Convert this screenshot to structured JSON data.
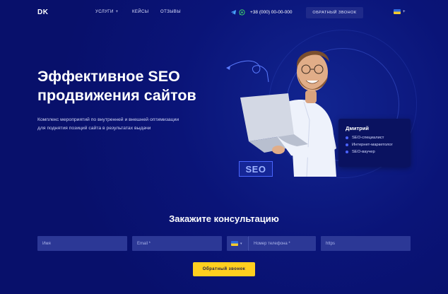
{
  "header": {
    "logo": "DK",
    "nav": {
      "services": "Услуги",
      "services_more": "+",
      "cases": "Кейсы",
      "contacts": "Отзывы"
    },
    "phone": "+38 (000) 00-00-000",
    "callback": "Обратный звонок",
    "lang_more": "+",
    "icons": [
      "telegram-icon",
      "whatsapp-icon",
      "ukraine-flag-icon"
    ]
  },
  "hero": {
    "title": "Эффективное SEO продвижения сайтов",
    "description": "Комплекс мероприятий по внутренней и внешней оптимизации для поднятия позиций сайта в результатах выдачи",
    "badge": "SEO"
  },
  "card": {
    "name": "Дмитрий",
    "items": [
      "SEO-специалист",
      "Интернет-маркетолог",
      "SEO-ваучер"
    ]
  },
  "form": {
    "title": "Закажите консультацию",
    "name_placeholder": "Имя",
    "email_placeholder": "Email *",
    "phone_placeholder": "Номер телефона *",
    "site_placeholder": "https",
    "submit": "Обратный звонок"
  },
  "colors": {
    "background": "#08106b",
    "accent": "#ffcf1f",
    "field": "#2c3896",
    "badge_border": "#4a66ff"
  }
}
